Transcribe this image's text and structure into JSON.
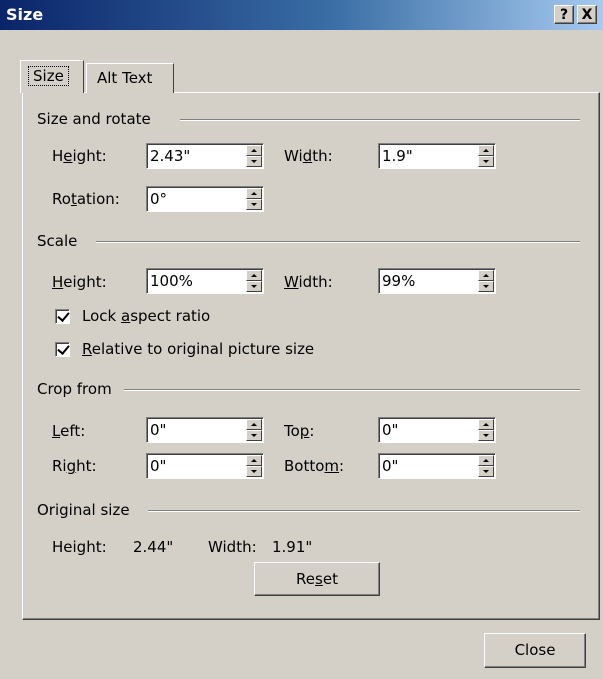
{
  "window": {
    "title": "Size",
    "help_label": "?",
    "close_label": "X"
  },
  "tabs": [
    {
      "label": "Size",
      "active": true
    },
    {
      "label": "Alt Text",
      "active": false
    }
  ],
  "size_rotate": {
    "heading": "Size and rotate",
    "height_pre": "H",
    "height_u": "e",
    "height_post": "ight:",
    "height_value": "2.43\"",
    "width_pre": "Wi",
    "width_u": "d",
    "width_post": "th:",
    "width_value": "1.9\"",
    "rotation_pre": "Ro",
    "rotation_u": "t",
    "rotation_post": "ation:",
    "rotation_value": "0°"
  },
  "scale": {
    "heading": "Scale",
    "height_pre": "",
    "height_u": "H",
    "height_post": "eight:",
    "height_value": "100%",
    "width_pre": "",
    "width_u": "W",
    "width_post": "idth:",
    "width_value": "99%",
    "lock_pre": "Lock ",
    "lock_u": "a",
    "lock_post": "spect ratio",
    "lock_checked": true,
    "relative_pre": "",
    "relative_u": "R",
    "relative_post": "elative to original picture size",
    "relative_checked": true
  },
  "crop": {
    "heading": "Crop from",
    "left_pre": "",
    "left_u": "L",
    "left_post": "eft:",
    "left_value": "0\"",
    "top_pre": "To",
    "top_u": "p",
    "top_post": ":",
    "top_value": "0\"",
    "right_pre": "Ri",
    "right_u": "g",
    "right_post": "ht:",
    "right_value": "0\"",
    "bottom_pre": "Botto",
    "bottom_u": "m",
    "bottom_post": ":",
    "bottom_value": "0\""
  },
  "original": {
    "heading": "Original size",
    "height_label": "Height:",
    "height_value": "2.44\"",
    "width_label": "Width:",
    "width_value": "1.91\"",
    "reset_pre": "Re",
    "reset_u": "s",
    "reset_post": "et"
  },
  "footer": {
    "close_label": "Close"
  }
}
